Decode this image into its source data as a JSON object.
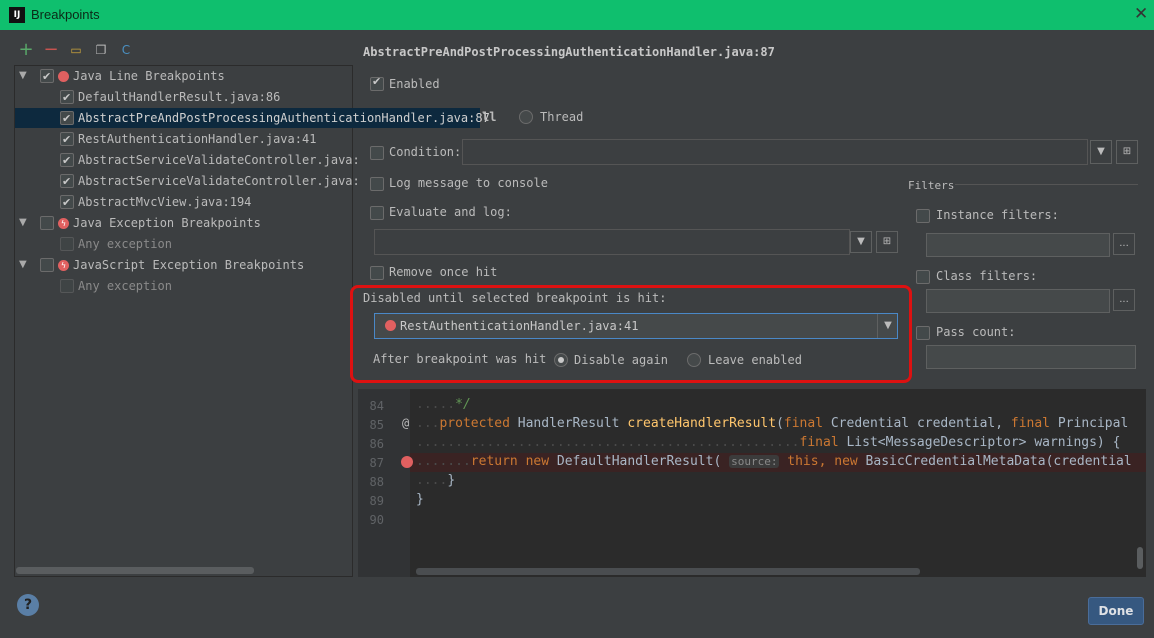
{
  "window": {
    "title": "Breakpoints",
    "close_glyph": "✕"
  },
  "toolbar": [
    {
      "icon": "add-icon",
      "glyph": "+",
      "color": "#59a869"
    },
    {
      "icon": "remove-icon",
      "glyph": "−",
      "color": "#c75450"
    },
    {
      "icon": "group-folder-icon",
      "glyph": "▭",
      "color": "#c9a33c"
    },
    {
      "icon": "copy-icon",
      "glyph": "❐",
      "color": "#bbbbbb"
    },
    {
      "icon": "class-icon",
      "glyph": "C",
      "color": "#4a90c2"
    }
  ],
  "tree": {
    "groups": [
      {
        "label": "Java Line Breakpoints",
        "checked": true,
        "icon": "red-breakpoint-icon",
        "items": [
          {
            "label": "DefaultHandlerResult.java:86",
            "checked": true
          },
          {
            "label": "AbstractPreAndPostProcessingAuthenticationHandler.java:87",
            "checked": true,
            "selected": true
          },
          {
            "label": "RestAuthenticationHandler.java:41",
            "checked": true
          },
          {
            "label": "AbstractServiceValidateController.java:",
            "checked": true
          },
          {
            "label": "AbstractServiceValidateController.java:",
            "checked": true
          },
          {
            "label": "AbstractMvcView.java:194",
            "checked": true
          }
        ]
      },
      {
        "label": "Java Exception Breakpoints",
        "checked": false,
        "icon": "exception-breakpoint-icon",
        "items": [
          {
            "label": "Any exception",
            "checked": false,
            "disabled": true
          }
        ]
      },
      {
        "label": "JavaScript Exception Breakpoints",
        "checked": false,
        "icon": "exception-breakpoint-icon",
        "items": [
          {
            "label": "Any exception",
            "checked": false,
            "disabled": true
          }
        ]
      }
    ]
  },
  "details": {
    "header": "AbstractPreAndPostProcessingAuthenticationHandler.java:87",
    "enabled_label": "Enabled",
    "suspend_partial": "ll",
    "thread_label": "Thread",
    "condition_label": "Condition:",
    "log_message_label": "Log message to console",
    "evaluate_label": "Evaluate and log:",
    "remove_once_label": "Remove once hit",
    "disabled_until_label": "Disabled until selected breakpoint is hit:",
    "disabled_until_value": "RestAuthenticationHandler.java:41",
    "after_hit_label": "After breakpoint was hit",
    "disable_again_label": "Disable again",
    "leave_enabled_label": "Leave enabled"
  },
  "filters": {
    "title": "Filters",
    "instance_label": "Instance filters:",
    "class_label": "Class filters:",
    "pass_count_label": "Pass count:",
    "more_glyph": "..."
  },
  "editor": {
    "lines": [
      {
        "num": "84",
        "text": "*/"
      },
      {
        "num": "85",
        "text": ""
      },
      {
        "num": "86",
        "text": ""
      },
      {
        "num": "87",
        "text": ""
      },
      {
        "num": "88",
        "text": "}"
      },
      {
        "num": "89",
        "text": "}"
      },
      {
        "num": "90",
        "text": ""
      }
    ],
    "l85_kw": "protected",
    "l85_type": "HandlerResult",
    "l85_fn": "createHandlerResult",
    "l85_rest1": "(",
    "l85_final1": "final",
    "l85_rest2": " Credential credential, ",
    "l85_final2": "final",
    "l85_rest3": " Principal",
    "l86_final": "final",
    "l86_rest": " List<MessageDescriptor> warnings) {",
    "l87_return": "return",
    "l87_new1": "new",
    "l87_rest1": " DefaultHandlerResult(",
    "l87_hint": "source:",
    "l87_this": "this,",
    "l87_new2": "new",
    "l87_rest2": " BasicCredentialMetaData(credential",
    "annotation_glyph": "@"
  },
  "footer": {
    "help_glyph": "?",
    "done_label": "Done"
  },
  "colors": {
    "titlebar": "#0fbf6e",
    "selection": "#0d293e",
    "highlight_box": "#dd1111",
    "breakpoint": "#e06060"
  }
}
